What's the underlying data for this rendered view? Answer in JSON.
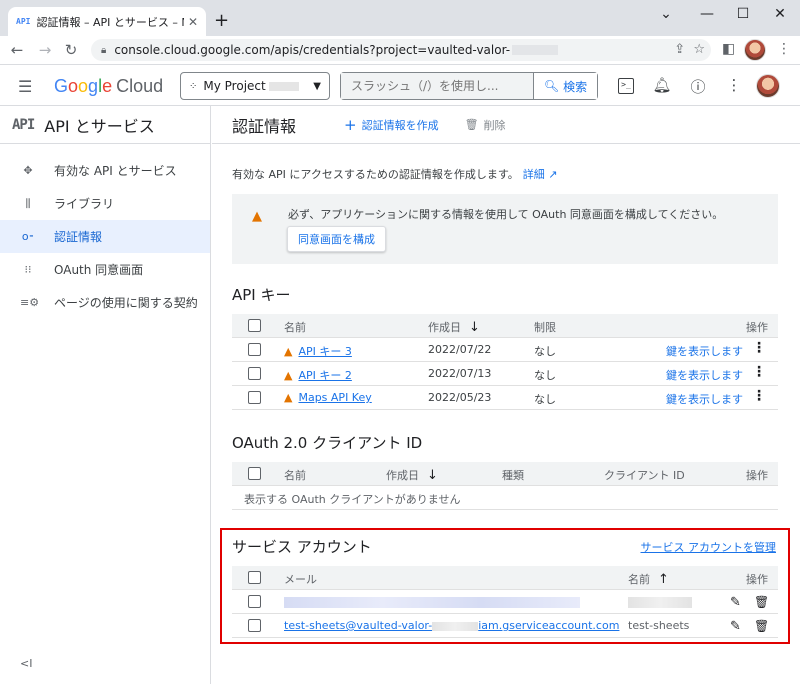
{
  "browser": {
    "tab_favicon": "API",
    "tab_title": "認証情報 – API とサービス – My Proje",
    "tab_close": "✕",
    "new_tab": "+",
    "url": "console.cloud.google.com/apis/credentials?project=vaulted-valor-",
    "window_controls": [
      "⌄",
      "—",
      "☐",
      "✕"
    ]
  },
  "header": {
    "logo_letters": [
      "G",
      "o",
      "o",
      "g",
      "l",
      "e"
    ],
    "logo_product": "Cloud",
    "project_name": "My Project",
    "search_placeholder": "スラッシュ（/）を使用し...",
    "search_button": "検索"
  },
  "sidebar": {
    "logo": "API",
    "title": "API とサービス",
    "items": [
      {
        "label": "有効な API とサービス",
        "icon": "enabled-apis-icon",
        "glyph": "✥"
      },
      {
        "label": "ライブラリ",
        "icon": "library-icon",
        "glyph": "⫼"
      },
      {
        "label": "認証情報",
        "icon": "key-icon",
        "glyph": "o⁃"
      },
      {
        "label": "OAuth 同意画面",
        "icon": "consent-screen-icon",
        "glyph": "⁝⁝"
      },
      {
        "label": "ページの使用に関する契約",
        "icon": "page-usage-icon",
        "glyph": "≡⚙"
      }
    ],
    "active_index": 2,
    "collapse": "<I"
  },
  "main": {
    "title": "認証情報",
    "create_label": "認証情報を作成",
    "delete_label": "削除",
    "intro_text": "有効な API にアクセスするための認証情報を作成します。",
    "intro_link": "詳細",
    "warning_text": "必ず、アプリケーションに関する情報を使用して OAuth 同意画面を構成してください。",
    "warning_button": "同意画面を構成"
  },
  "api_keys": {
    "title": "API キー",
    "columns": [
      "名前",
      "作成日",
      "制限",
      "操作"
    ],
    "rows": [
      {
        "name": "API キー 3",
        "created": "2022/07/22",
        "restriction": "なし",
        "action": "鍵を表示します"
      },
      {
        "name": "API キー 2",
        "created": "2022/07/13",
        "restriction": "なし",
        "action": "鍵を表示します"
      },
      {
        "name": "Maps API Key",
        "created": "2022/05/23",
        "restriction": "なし",
        "action": "鍵を表示します"
      }
    ]
  },
  "oauth": {
    "title": "OAuth 2.0 クライアント ID",
    "columns": [
      "名前",
      "作成日",
      "種類",
      "クライアント ID",
      "操作"
    ],
    "empty_text": "表示する OAuth クライアントがありません"
  },
  "service_accounts": {
    "title": "サービス アカウント",
    "manage_link": "サービス アカウントを管理",
    "columns": [
      "メール",
      "名前",
      "操作"
    ],
    "rows": [
      {
        "email": "",
        "name": ""
      },
      {
        "email": "test-sheets@vaulted-valor-",
        "email_suffix": "iam.gserviceaccount.com",
        "name": "test-sheets"
      }
    ]
  },
  "colors": {
    "accent": "#1a73e8",
    "active_bg": "#e8f0fe",
    "warning": "#e37400",
    "highlight_border": "#e00000"
  }
}
